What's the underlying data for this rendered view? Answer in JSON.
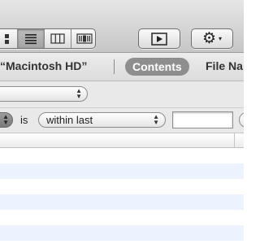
{
  "toolbar": {
    "view_buttons": [
      {
        "name": "icon-view",
        "icon": "icon-grid-icon",
        "active": false
      },
      {
        "name": "list-view",
        "icon": "list-lines-icon",
        "active": true
      },
      {
        "name": "column-view",
        "icon": "columns-icon",
        "active": false
      },
      {
        "name": "coverflow-view",
        "icon": "coverflow-icon",
        "active": false
      }
    ],
    "quicklook_icon": "play-icon",
    "action_icon": "gear-icon",
    "action_glyph": "⚙",
    "action_caret": "▾"
  },
  "scope": {
    "this_mac": "“Macintosh HD”",
    "contents_label": "Contents",
    "filename_label": "File Na",
    "selected_color": "#8e8e8e"
  },
  "criteria": {
    "operator_label": "is",
    "date_condition": "within last",
    "count_value": ""
  },
  "colors": {
    "row_even": "#edf3fe",
    "row_odd": "#ffffff"
  }
}
